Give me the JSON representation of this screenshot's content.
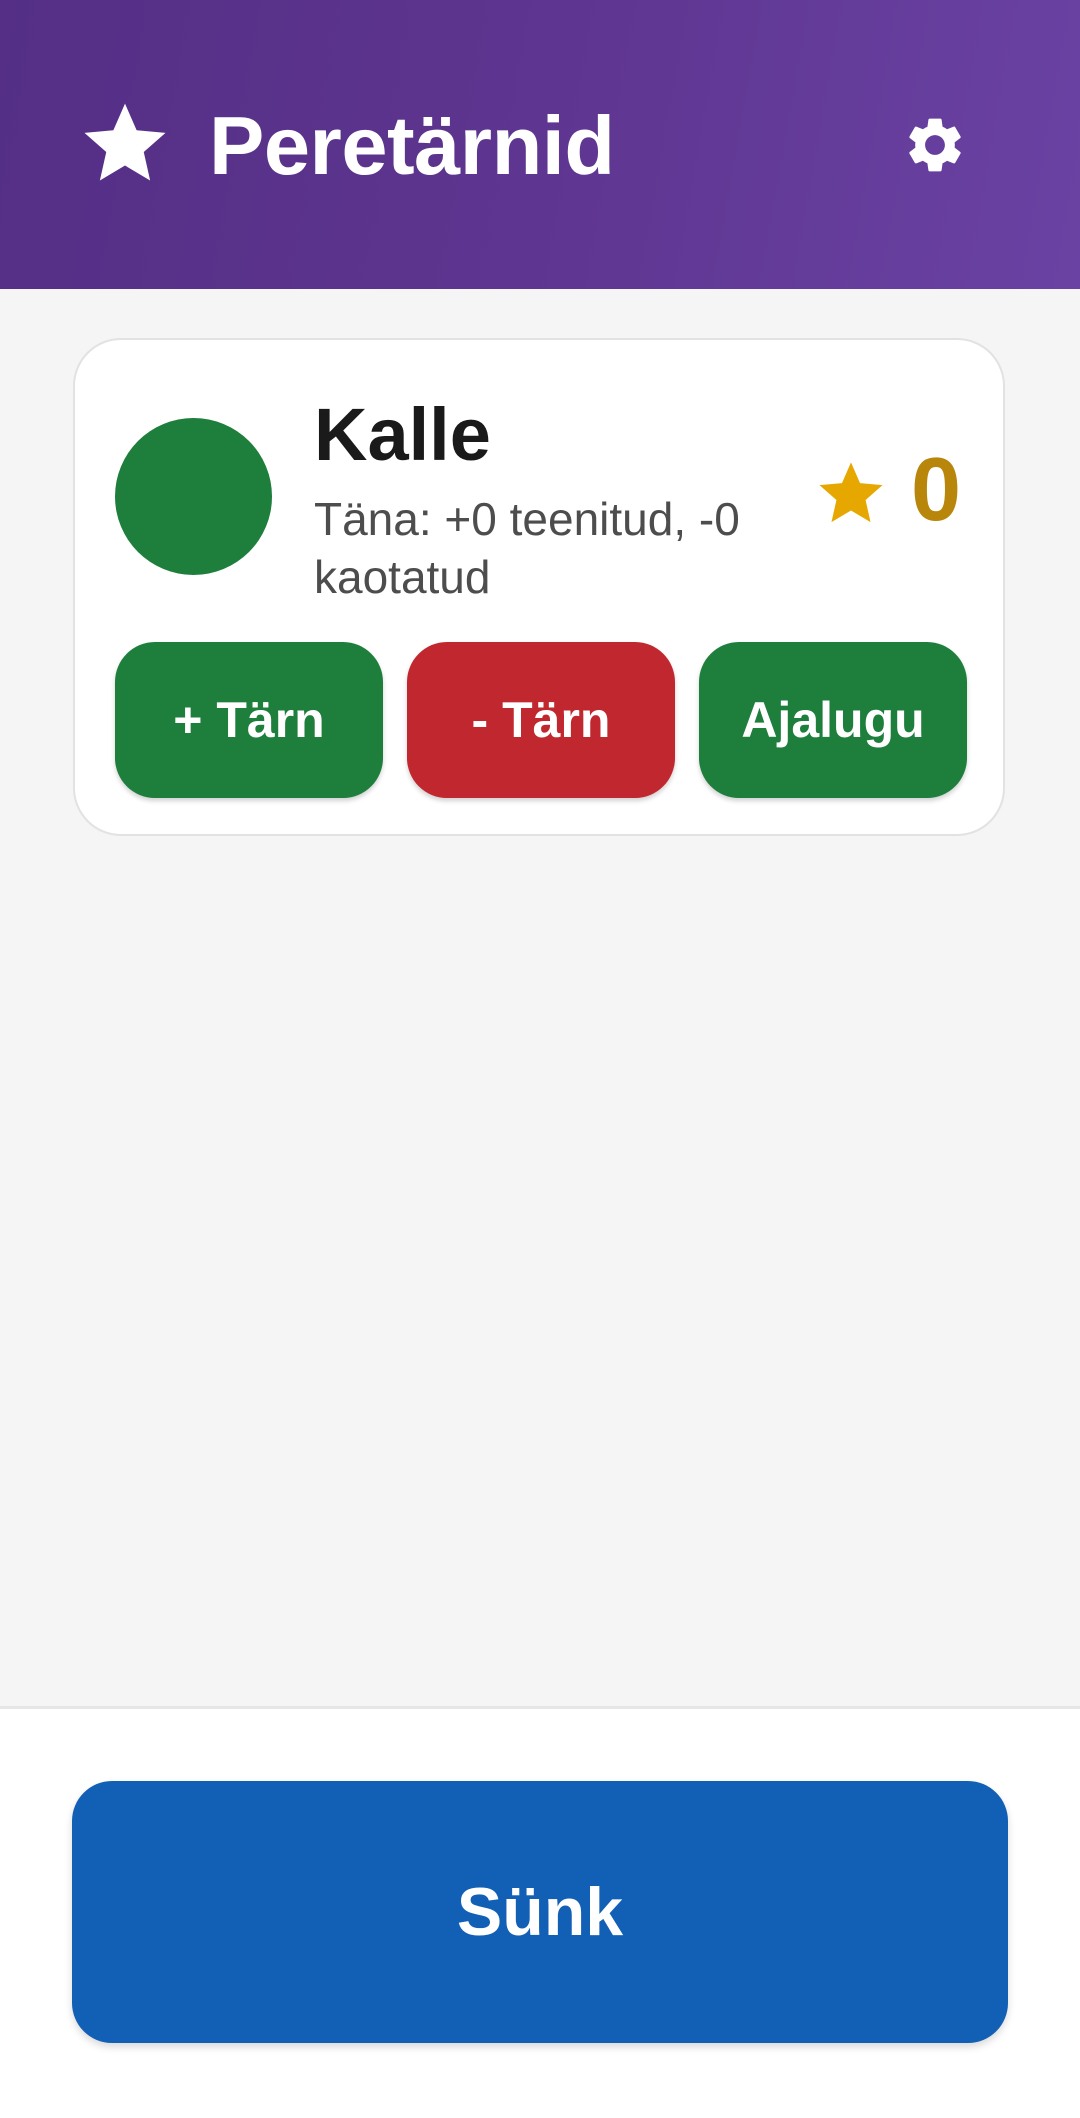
{
  "app_bar": {
    "title": "Peretärnid",
    "logo_icon": "star-icon",
    "settings_icon": "gear-icon"
  },
  "children": [
    {
      "name": "Kalle",
      "avatar_color": "#1e7e3c",
      "today_summary": "Täna: +0 teenitud, -0 kaotatud",
      "score_icon": "star-icon",
      "score": "0",
      "actions": {
        "add_label": "+ Tärn",
        "remove_label": "- Tärn",
        "history_label": "Ajalugu"
      }
    }
  ],
  "footer": {
    "sync_label": "Sünk"
  },
  "colors": {
    "header_start": "#542f85",
    "header_end": "#6a42a3",
    "positive": "#1e7e3c",
    "negative": "#c0272f",
    "primary": "#1160b5",
    "star": "#e6a800",
    "score_text": "#b8860b"
  }
}
